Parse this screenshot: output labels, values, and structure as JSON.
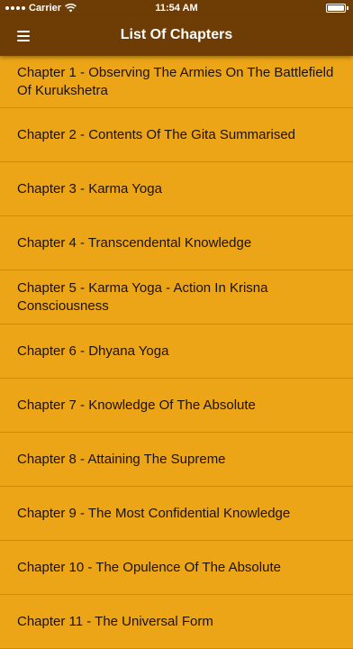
{
  "status_bar": {
    "carrier": "Carrier",
    "time": "11:54 AM",
    "battery_level": 1.0
  },
  "nav_bar": {
    "title": "List Of Chapters",
    "menu_icon": "hamburger-menu-icon"
  },
  "chapters": [
    "Chapter 1 - Observing The Armies On The Battlefield Of Kurukshetra",
    "Chapter 2 - Contents Of The Gita Summarised",
    "Chapter 3 - Karma Yoga",
    "Chapter 4 - Transcendental Knowledge",
    "Chapter 5 - Karma Yoga - Action In Krisna Consciousness",
    "Chapter 6 - Dhyana Yoga",
    "Chapter 7 - Knowledge Of The Absolute",
    "Chapter 8 - Attaining The Supreme",
    "Chapter 9 - The Most Confidential Knowledge",
    "Chapter 10 - The Opulence Of The Absolute",
    "Chapter 11 - The Universal Form"
  ],
  "colors": {
    "nav_background": "#6E3D05",
    "list_background": "#EDA518",
    "text": "#1c1205"
  }
}
